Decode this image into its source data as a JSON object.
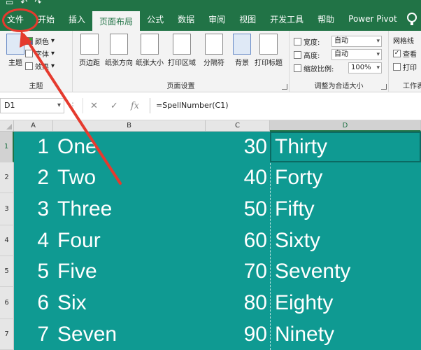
{
  "tabs": [
    {
      "label": "文件"
    },
    {
      "label": "开始"
    },
    {
      "label": "插入"
    },
    {
      "label": "页面布局"
    },
    {
      "label": "公式"
    },
    {
      "label": "数据"
    },
    {
      "label": "审阅"
    },
    {
      "label": "视图"
    },
    {
      "label": "开发工具"
    },
    {
      "label": "帮助"
    },
    {
      "label": "Power Pivot"
    }
  ],
  "active_tab": "页面布局",
  "ribbon": {
    "theme_group": {
      "label": "主题",
      "theme_button": "主题",
      "colors": "颜色",
      "fonts": "字体",
      "effects": "效果"
    },
    "page_setup_group": {
      "label": "页面设置",
      "buttons": [
        "页边距",
        "纸张方向",
        "纸张大小",
        "打印区域",
        "分隔符",
        "背景",
        "打印标题"
      ]
    },
    "scale_group": {
      "label": "调整为合适大小",
      "width_label": "宽度:",
      "width_value": "自动",
      "height_label": "高度:",
      "height_value": "自动",
      "scale_label": "缩放比例:",
      "scale_value": "100%"
    },
    "sheet_options_group": {
      "label": "工作表",
      "gridlines": "网格线",
      "view": "查看",
      "print": "打印"
    }
  },
  "formula_bar": {
    "name_box": "D1",
    "formula": "=SpellNumber(C1)"
  },
  "columns": [
    "A",
    "B",
    "C",
    "D"
  ],
  "rows": [
    {
      "row": "1",
      "a": "1",
      "b": "One",
      "c": "30",
      "d": "Thirty"
    },
    {
      "row": "2",
      "a": "2",
      "b": "Two",
      "c": "40",
      "d": "Forty"
    },
    {
      "row": "3",
      "a": "3",
      "b": "Three",
      "c": "50",
      "d": "Fifty"
    },
    {
      "row": "4",
      "a": "4",
      "b": "Four",
      "c": "60",
      "d": "Sixty"
    },
    {
      "row": "5",
      "a": "5",
      "b": "Five",
      "c": "70",
      "d": "Seventy"
    },
    {
      "row": "6",
      "a": "6",
      "b": "Six",
      "c": "80",
      "d": "Eighty"
    },
    {
      "row": "7",
      "a": "7",
      "b": "Seven",
      "c": "90",
      "d": "Ninety"
    }
  ],
  "colors": {
    "excel_green": "#217346",
    "cell_fill": "#0f9a92",
    "annotation_red": "#e53a2e"
  }
}
